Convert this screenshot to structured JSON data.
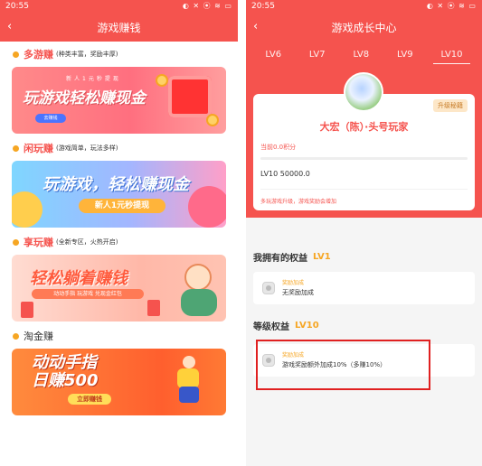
{
  "left": {
    "status": {
      "time": "20:55",
      "icons": "◐ ✕ ⦿ ≋ ▭"
    },
    "title": "游戏赚钱",
    "sections": [
      {
        "name": "多游赚",
        "desc": "(种类丰富，奖励丰厚)",
        "banner": {
          "caption": "新人1元秒提现",
          "headline": "玩游戏轻松赚现金",
          "button": "去赚钱"
        }
      },
      {
        "name": "闲玩赚",
        "desc": "(游戏简单，玩法多样)",
        "banner": {
          "headline": "玩游戏，轻松赚现金",
          "button": "新人1元秒提现"
        }
      },
      {
        "name": "享玩赚",
        "desc": "(全新专区，火热开启)",
        "banner": {
          "headline": "轻松躺着赚钱",
          "sub": "动动手指 玩游戏 兑现金红包"
        }
      },
      {
        "name": "淘金赚",
        "desc": "",
        "banner": {
          "headline": "动动手指",
          "headline2": "日赚500",
          "button": "立即赚钱"
        }
      }
    ]
  },
  "right": {
    "status": {
      "time": "20:55",
      "icons": "◐ ✕ ⦿ ≋ ▭"
    },
    "title": "游戏成长中心",
    "tabs": [
      "LV6",
      "LV7",
      "LV8",
      "LV9",
      "LV10"
    ],
    "active_tab": "LV10",
    "badge": "升级秘籍",
    "username": "大宏（陈）·头号玩家",
    "points": "当前0.0积分",
    "progress": 0,
    "next_level": "LV10 50000.0",
    "hint": "多玩游戏升级，游戏奖励会增加",
    "owned_title": "我拥有的权益",
    "owned_level": "LV1",
    "owned_benefit": {
      "label": "奖励加成",
      "value": "无奖励加成"
    },
    "level_title": "等级权益",
    "level_level": "LV10",
    "level_benefit": {
      "label": "奖励加成",
      "value": "游戏奖励额外加成10%（多赚10%）"
    }
  },
  "colors": {
    "primary": "#f5534e",
    "accent": "#f6a623"
  }
}
